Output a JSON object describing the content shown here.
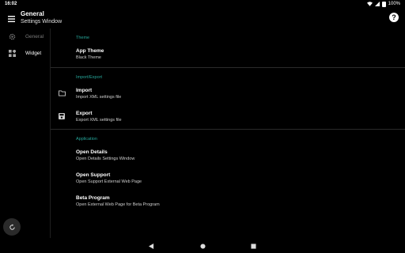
{
  "status_bar": {
    "time": "16:02",
    "battery": "100%"
  },
  "app_bar": {
    "title": "General",
    "subtitle": "Settings Window"
  },
  "sidebar": {
    "items": [
      {
        "label": "General",
        "icon": "gear-icon"
      },
      {
        "label": "Widget",
        "icon": "widget-grid-icon"
      }
    ]
  },
  "sections": {
    "theme": {
      "header": "Theme",
      "app_theme": {
        "title": "App Theme",
        "summary": "Black Theme"
      }
    },
    "import_export": {
      "header": "Import/Export",
      "import": {
        "title": "Import",
        "summary": "Import XML settings file",
        "icon": "folder-icon"
      },
      "export": {
        "title": "Export",
        "summary": "Export XML settings file",
        "icon": "save-icon"
      }
    },
    "application": {
      "header": "Application",
      "open_details": {
        "title": "Open Details",
        "summary": "Open Details Settings Window"
      },
      "open_support": {
        "title": "Open Support",
        "summary": "Open Support External Web Page"
      },
      "beta_program": {
        "title": "Beta Program",
        "summary": "Open External Web Page for Beta Program"
      }
    }
  },
  "colors": {
    "accent": "#26a69a",
    "background": "#000000"
  },
  "nav_bar": {
    "icons": [
      "back-icon",
      "home-icon",
      "recents-icon"
    ]
  }
}
